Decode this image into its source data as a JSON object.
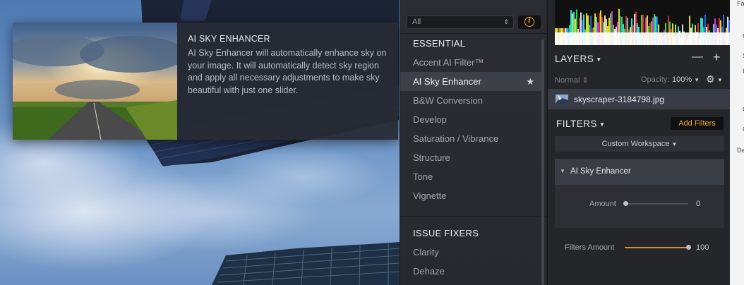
{
  "tooltip": {
    "title": "AI SKY ENHANCER",
    "description": "AI Sky Enhancer will automatically enhance sky on your image. It will automatically detect sky region and apply all necessary adjustments to make sky beautiful with just one slider."
  },
  "catalog": {
    "filter_value": "All",
    "info_icon": "info-icon",
    "sections": [
      {
        "title": "ESSENTIAL",
        "items": [
          "Accent AI Filter™",
          "AI Sky Enhancer",
          "B&W Conversion",
          "Develop",
          "Saturation / Vibrance",
          "Structure",
          "Tone",
          "Vignette"
        ]
      },
      {
        "title": "ISSUE FIXERS",
        "items": [
          "Clarity",
          "Dehaze"
        ]
      }
    ],
    "active_item": "AI Sky Enhancer"
  },
  "layers": {
    "title": "LAYERS",
    "minus": "—",
    "plus": "+",
    "blend_mode": "Normal",
    "opacity_label": "Opacity:",
    "opacity_value": "100%",
    "layer_name": "skyscraper-3184798.jpg"
  },
  "filters": {
    "title": "FILTERS",
    "add_button": "Add Filters",
    "workspace": "Custom Workspace",
    "card": {
      "name": "AI Sky Enhancer",
      "amount_label": "Amount",
      "amount_value": "0"
    },
    "filters_amount_label": "Filters Amount",
    "filters_amount_value": "100",
    "amount_level": 0,
    "filters_amount_level": 1.0
  },
  "strip": {
    "a": "Fa",
    "b": "C",
    "c": "S",
    "d": "I",
    "e": "C",
    "f": "C",
    "g": "De"
  },
  "colors": {
    "accent": "#f0a83a",
    "panel": "#25262a",
    "active_row": "#3e4047"
  }
}
